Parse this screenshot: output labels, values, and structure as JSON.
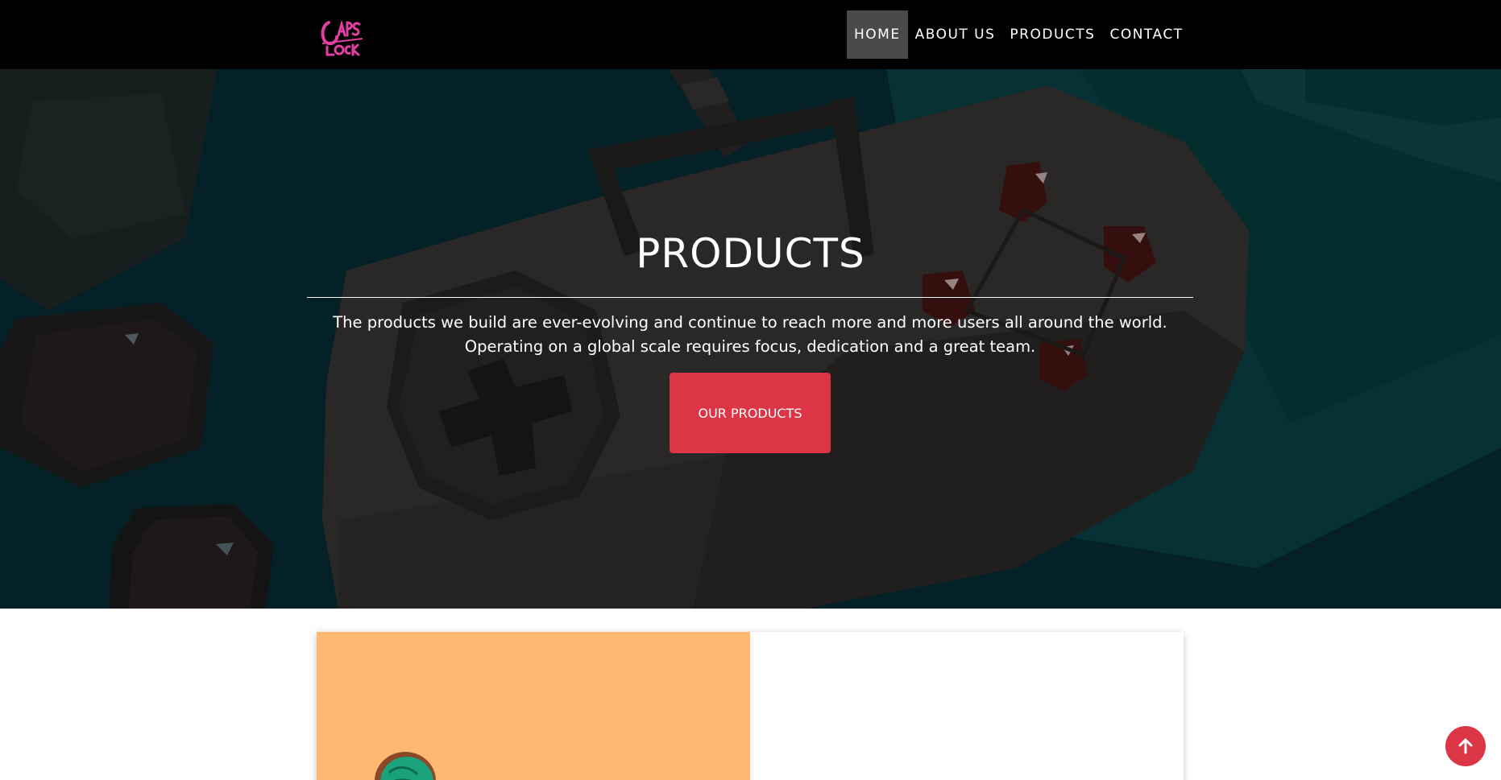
{
  "logo": {
    "icon": "capslock-logo-icon",
    "color": "#e040a0"
  },
  "nav": {
    "items": [
      {
        "label": "HOME",
        "active": true
      },
      {
        "label": "ABOUT US",
        "active": false
      },
      {
        "label": "PRODUCTS",
        "active": false
      },
      {
        "label": "CONTACT",
        "active": false
      }
    ]
  },
  "hero": {
    "title": "PRODUCTS",
    "line1": "The products we build are ever-evolving and continue to reach more and more users all around the world.",
    "line2": "Operating on a global scale requires focus, dedication and a great team.",
    "button_label": "OUR PRODUCTS",
    "background_icon": "game-controller-illustration",
    "colors": {
      "background": "#05343a",
      "button": "#dc3545"
    }
  },
  "card": {
    "image_background": "#ffb871",
    "image_icon": "product-illustration-icon"
  },
  "scroll_top": {
    "icon": "arrow-up-icon",
    "color": "#dc3545"
  }
}
